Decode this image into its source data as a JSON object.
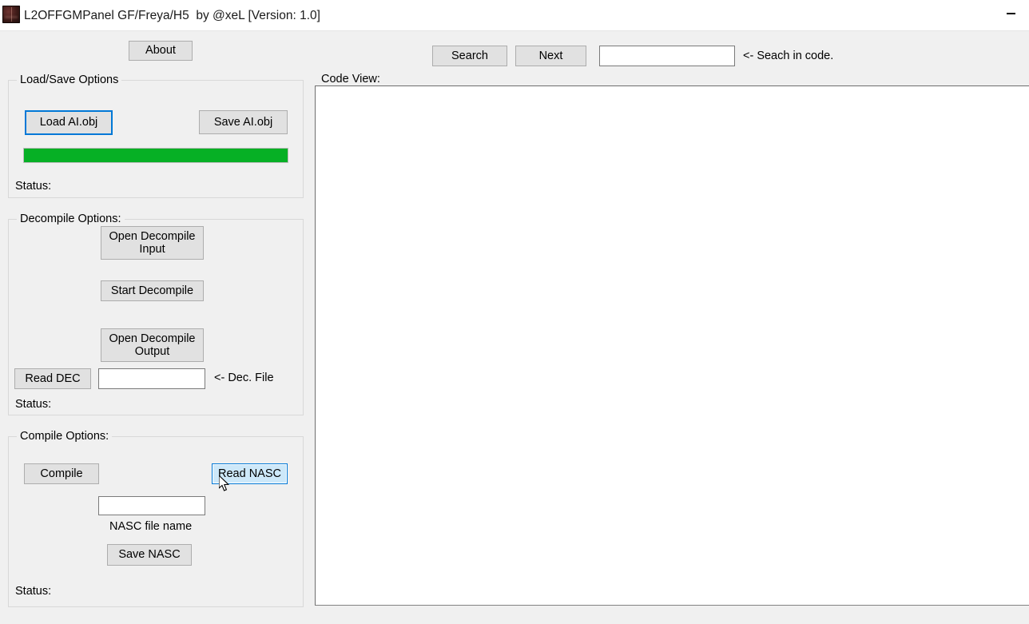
{
  "window": {
    "title": "L2OFFGMPanel GF/Freya/H5  by @xeL [Version: 1.0]",
    "icon": "app-icon",
    "minimize_label": "—",
    "background_color": "#f0f0f0"
  },
  "toolbar": {
    "about_label": "About",
    "search_label": "Search",
    "next_label": "Next",
    "search_value": "",
    "search_placeholder": "",
    "search_hint": "<- Seach in code."
  },
  "load_save": {
    "group_title": "Load/Save Options",
    "load_label": "Load AI.obj",
    "save_label": "Save AI.obj",
    "progress_percent": 100,
    "progress_color": "#06b025",
    "status_label": "Status:",
    "status_value": ""
  },
  "decompile": {
    "group_title": "Decompile Options:",
    "open_input_label": "Open Decompile\nInput",
    "start_label": "Start Decompile",
    "open_output_label": "Open Decompile\nOutput",
    "read_dec_label": "Read DEC",
    "dec_file_value": "",
    "dec_file_hint": "<- Dec. File",
    "status_label": "Status:",
    "status_value": ""
  },
  "compile": {
    "group_title": "Compile Options:",
    "compile_label": "Compile",
    "read_nasc_label": "Read NASC",
    "nasc_file_value": "",
    "nasc_file_caption": "NASC file name",
    "save_nasc_label": "Save NASC",
    "status_label": "Status:",
    "status_value": ""
  },
  "code_view": {
    "group_title": "Code View:",
    "content": "",
    "placeholder": ""
  },
  "theme": {
    "focus_border": "#0078d7",
    "hover_fill": "#cde8f9",
    "button_face": "#e1e1e1",
    "button_border": "#adadad"
  }
}
